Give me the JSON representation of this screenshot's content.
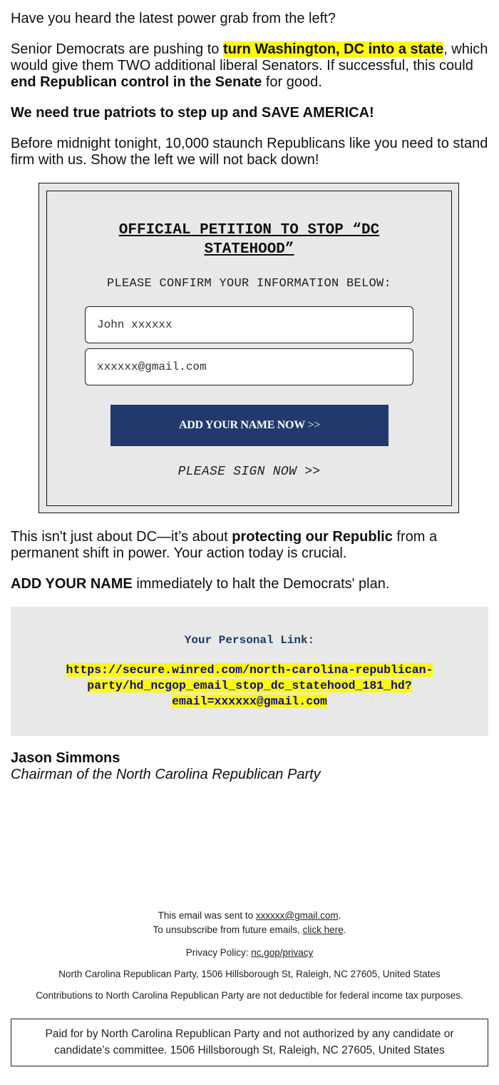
{
  "intro": {
    "question": "Have you heard the latest power grab from the left?",
    "para2_pre": "Senior Democrats are pushing to ",
    "para2_highlight": "turn Washington, DC into a state",
    "para2_mid": ", which would give them TWO additional liberal Senators. If successful, this could ",
    "para2_bold": "end Republican control in the Senate",
    "para2_post": " for good.",
    "rally": "We need true patriots to step up and SAVE AMERICA!",
    "deadline": "Before midnight tonight, 10,000 staunch Republicans like you need to stand firm with us. Show the left we will not back down!"
  },
  "petition": {
    "title": "OFFICIAL PETITION TO STOP “DC STATEHOOD”",
    "subtitle": "PLEASE CONFIRM YOUR INFORMATION BELOW:",
    "name_value": "John xxxxxx",
    "email_value": "xxxxxx@gmail.com",
    "button_label": "ADD YOUR NAME NOW",
    "button_arrows": " >>",
    "sign_now": "PLEASE SIGN NOW >>"
  },
  "body": {
    "para_pre": "This isn't just about DC—it’s about ",
    "para_bold": "protecting our Republic",
    "para_post": " from a permanent shift in power. Your action today is crucial.",
    "cta_bold": "ADD YOUR NAME",
    "cta_post": " immediately to halt the Democrats' plan."
  },
  "personal_link": {
    "label": "Your Personal Link:",
    "url": "https://secure.winred.com/north-carolina-republican-party/hd_ncgop_email_stop_dc_statehood_181_hd?email=xxxxxx@gmail.com",
    "line1": "https://secure.winred.com/north-carolina-republican-",
    "line2": "party/hd_ncgop_email_stop_dc_statehood_181_hd?",
    "line3": "email=xxxxxx@gmail.com"
  },
  "signature": {
    "name": "Jason Simmons",
    "title": "Chairman of the North Carolina Republican Party"
  },
  "footer": {
    "sent_to_pre": "This email was sent to ",
    "sent_to_email": "xxxxxx@gmail.com",
    "sent_to_post": ".",
    "unsub_pre": "To unsubscribe from future emails, ",
    "unsub_link": "click here",
    "unsub_post": ".",
    "privacy_pre": "Privacy Policy: ",
    "privacy_link": "nc.gop/privacy",
    "address": "North Carolina Republican Party, 1506 Hillsborough St, Raleigh, NC 27605, United States",
    "contributions": "Contributions to North Carolina Republican Party are not deductible for federal income tax purposes.",
    "paid_for_line1": "Paid for by North Carolina Republican Party and not authorized by any candidate or",
    "paid_for_line2": "candidate’s committee. 1506 Hillsborough St, Raleigh, NC 27605, United States"
  },
  "colors": {
    "highlight": "#fffb00",
    "button": "#213a6b",
    "link_label": "#1f3a6b",
    "url_text": "#0b0ba0",
    "panel_gray": "#e8e8e8"
  }
}
